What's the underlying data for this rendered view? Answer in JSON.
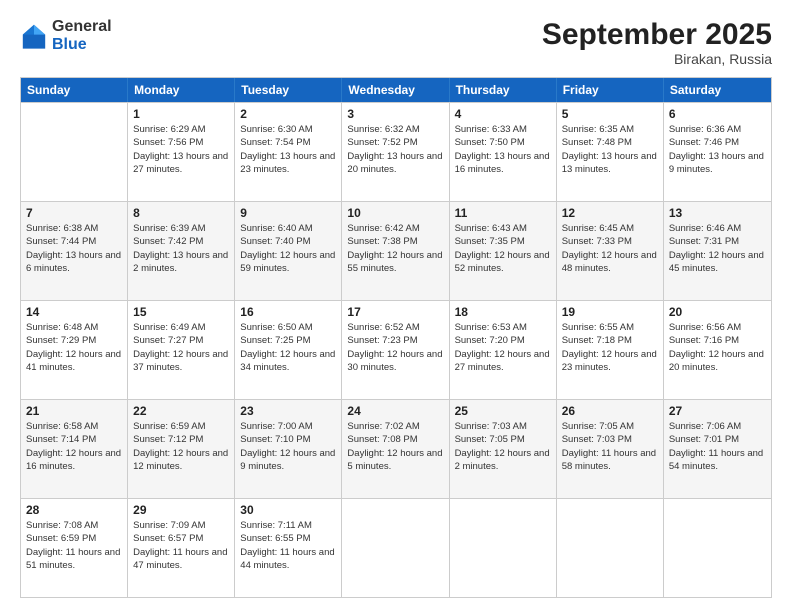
{
  "logo": {
    "general": "General",
    "blue": "Blue"
  },
  "title": "September 2025",
  "location": "Birakan, Russia",
  "days": [
    "Sunday",
    "Monday",
    "Tuesday",
    "Wednesday",
    "Thursday",
    "Friday",
    "Saturday"
  ],
  "weeks": [
    [
      {
        "day": "",
        "sunrise": "",
        "sunset": "",
        "daylight": ""
      },
      {
        "day": "1",
        "sunrise": "Sunrise: 6:29 AM",
        "sunset": "Sunset: 7:56 PM",
        "daylight": "Daylight: 13 hours and 27 minutes."
      },
      {
        "day": "2",
        "sunrise": "Sunrise: 6:30 AM",
        "sunset": "Sunset: 7:54 PM",
        "daylight": "Daylight: 13 hours and 23 minutes."
      },
      {
        "day": "3",
        "sunrise": "Sunrise: 6:32 AM",
        "sunset": "Sunset: 7:52 PM",
        "daylight": "Daylight: 13 hours and 20 minutes."
      },
      {
        "day": "4",
        "sunrise": "Sunrise: 6:33 AM",
        "sunset": "Sunset: 7:50 PM",
        "daylight": "Daylight: 13 hours and 16 minutes."
      },
      {
        "day": "5",
        "sunrise": "Sunrise: 6:35 AM",
        "sunset": "Sunset: 7:48 PM",
        "daylight": "Daylight: 13 hours and 13 minutes."
      },
      {
        "day": "6",
        "sunrise": "Sunrise: 6:36 AM",
        "sunset": "Sunset: 7:46 PM",
        "daylight": "Daylight: 13 hours and 9 minutes."
      }
    ],
    [
      {
        "day": "7",
        "sunrise": "Sunrise: 6:38 AM",
        "sunset": "Sunset: 7:44 PM",
        "daylight": "Daylight: 13 hours and 6 minutes."
      },
      {
        "day": "8",
        "sunrise": "Sunrise: 6:39 AM",
        "sunset": "Sunset: 7:42 PM",
        "daylight": "Daylight: 13 hours and 2 minutes."
      },
      {
        "day": "9",
        "sunrise": "Sunrise: 6:40 AM",
        "sunset": "Sunset: 7:40 PM",
        "daylight": "Daylight: 12 hours and 59 minutes."
      },
      {
        "day": "10",
        "sunrise": "Sunrise: 6:42 AM",
        "sunset": "Sunset: 7:38 PM",
        "daylight": "Daylight: 12 hours and 55 minutes."
      },
      {
        "day": "11",
        "sunrise": "Sunrise: 6:43 AM",
        "sunset": "Sunset: 7:35 PM",
        "daylight": "Daylight: 12 hours and 52 minutes."
      },
      {
        "day": "12",
        "sunrise": "Sunrise: 6:45 AM",
        "sunset": "Sunset: 7:33 PM",
        "daylight": "Daylight: 12 hours and 48 minutes."
      },
      {
        "day": "13",
        "sunrise": "Sunrise: 6:46 AM",
        "sunset": "Sunset: 7:31 PM",
        "daylight": "Daylight: 12 hours and 45 minutes."
      }
    ],
    [
      {
        "day": "14",
        "sunrise": "Sunrise: 6:48 AM",
        "sunset": "Sunset: 7:29 PM",
        "daylight": "Daylight: 12 hours and 41 minutes."
      },
      {
        "day": "15",
        "sunrise": "Sunrise: 6:49 AM",
        "sunset": "Sunset: 7:27 PM",
        "daylight": "Daylight: 12 hours and 37 minutes."
      },
      {
        "day": "16",
        "sunrise": "Sunrise: 6:50 AM",
        "sunset": "Sunset: 7:25 PM",
        "daylight": "Daylight: 12 hours and 34 minutes."
      },
      {
        "day": "17",
        "sunrise": "Sunrise: 6:52 AM",
        "sunset": "Sunset: 7:23 PM",
        "daylight": "Daylight: 12 hours and 30 minutes."
      },
      {
        "day": "18",
        "sunrise": "Sunrise: 6:53 AM",
        "sunset": "Sunset: 7:20 PM",
        "daylight": "Daylight: 12 hours and 27 minutes."
      },
      {
        "day": "19",
        "sunrise": "Sunrise: 6:55 AM",
        "sunset": "Sunset: 7:18 PM",
        "daylight": "Daylight: 12 hours and 23 minutes."
      },
      {
        "day": "20",
        "sunrise": "Sunrise: 6:56 AM",
        "sunset": "Sunset: 7:16 PM",
        "daylight": "Daylight: 12 hours and 20 minutes."
      }
    ],
    [
      {
        "day": "21",
        "sunrise": "Sunrise: 6:58 AM",
        "sunset": "Sunset: 7:14 PM",
        "daylight": "Daylight: 12 hours and 16 minutes."
      },
      {
        "day": "22",
        "sunrise": "Sunrise: 6:59 AM",
        "sunset": "Sunset: 7:12 PM",
        "daylight": "Daylight: 12 hours and 12 minutes."
      },
      {
        "day": "23",
        "sunrise": "Sunrise: 7:00 AM",
        "sunset": "Sunset: 7:10 PM",
        "daylight": "Daylight: 12 hours and 9 minutes."
      },
      {
        "day": "24",
        "sunrise": "Sunrise: 7:02 AM",
        "sunset": "Sunset: 7:08 PM",
        "daylight": "Daylight: 12 hours and 5 minutes."
      },
      {
        "day": "25",
        "sunrise": "Sunrise: 7:03 AM",
        "sunset": "Sunset: 7:05 PM",
        "daylight": "Daylight: 12 hours and 2 minutes."
      },
      {
        "day": "26",
        "sunrise": "Sunrise: 7:05 AM",
        "sunset": "Sunset: 7:03 PM",
        "daylight": "Daylight: 11 hours and 58 minutes."
      },
      {
        "day": "27",
        "sunrise": "Sunrise: 7:06 AM",
        "sunset": "Sunset: 7:01 PM",
        "daylight": "Daylight: 11 hours and 54 minutes."
      }
    ],
    [
      {
        "day": "28",
        "sunrise": "Sunrise: 7:08 AM",
        "sunset": "Sunset: 6:59 PM",
        "daylight": "Daylight: 11 hours and 51 minutes."
      },
      {
        "day": "29",
        "sunrise": "Sunrise: 7:09 AM",
        "sunset": "Sunset: 6:57 PM",
        "daylight": "Daylight: 11 hours and 47 minutes."
      },
      {
        "day": "30",
        "sunrise": "Sunrise: 7:11 AM",
        "sunset": "Sunset: 6:55 PM",
        "daylight": "Daylight: 11 hours and 44 minutes."
      },
      {
        "day": "",
        "sunrise": "",
        "sunset": "",
        "daylight": ""
      },
      {
        "day": "",
        "sunrise": "",
        "sunset": "",
        "daylight": ""
      },
      {
        "day": "",
        "sunrise": "",
        "sunset": "",
        "daylight": ""
      },
      {
        "day": "",
        "sunrise": "",
        "sunset": "",
        "daylight": ""
      }
    ]
  ]
}
